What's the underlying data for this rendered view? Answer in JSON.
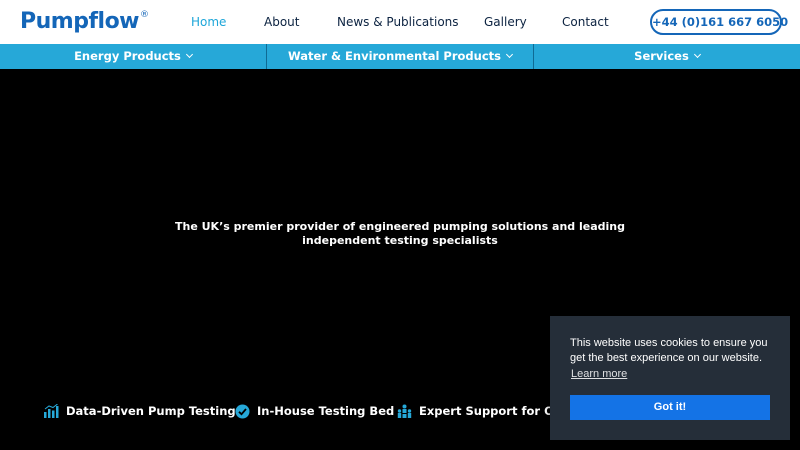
{
  "header": {
    "logo_text": "Pumpflow",
    "logo_mark": "®",
    "brand_color": "#1466b8",
    "nav": [
      {
        "label": "Home",
        "active": true
      },
      {
        "label": "About",
        "active": false
      },
      {
        "label": "News & Publications",
        "active": false
      },
      {
        "label": "Gallery",
        "active": false
      },
      {
        "label": "Contact",
        "active": false
      }
    ],
    "phone": "+44 (0)161 667 6050"
  },
  "subnav": {
    "background": "#26a8d8",
    "items": [
      {
        "label": "Energy Products"
      },
      {
        "label": "Water & Environmental Products"
      },
      {
        "label": "Services"
      }
    ]
  },
  "hero": {
    "tagline": "The UK’s premier provider of engineered pumping solutions and leading independent testing specialists"
  },
  "features": [
    {
      "label": "Data-Driven Pump Testing",
      "icon": "bar-chart-icon"
    },
    {
      "label": "In-House Testing Bed",
      "icon": "verified-badge-icon"
    },
    {
      "label": "Expert Support for OEMs",
      "icon": "team-icon"
    }
  ],
  "cookie": {
    "message": "This website uses cookies to ensure you get the best experience on our website.",
    "learn_more": "Learn more",
    "button": "Got it!"
  }
}
